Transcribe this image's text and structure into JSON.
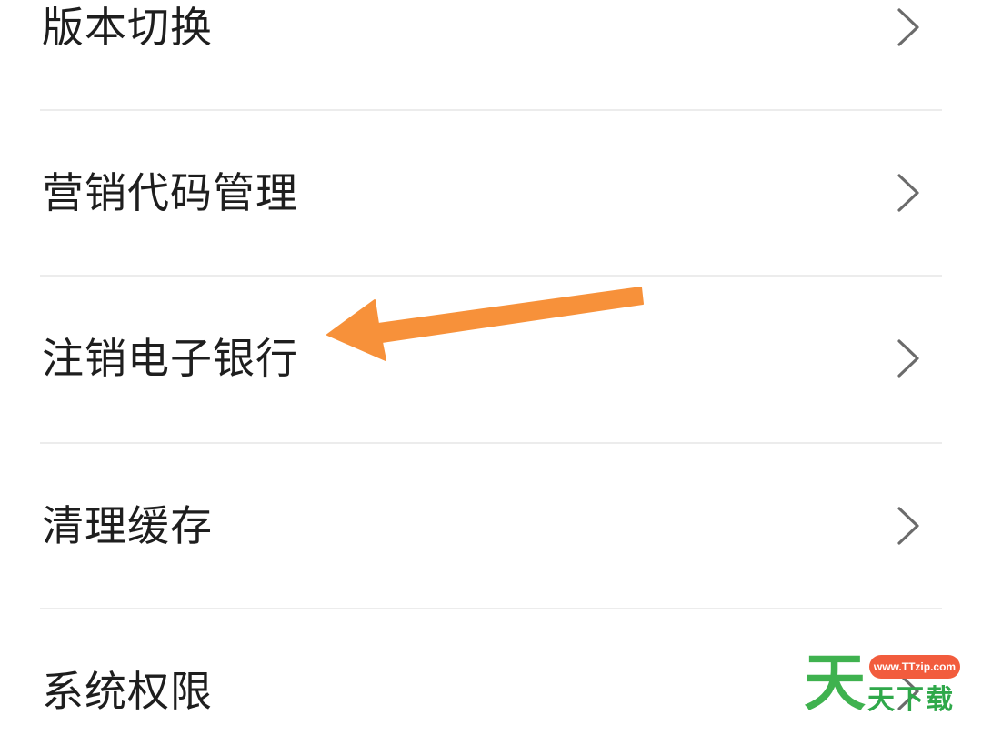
{
  "menu": {
    "items": [
      {
        "label": "版本切换"
      },
      {
        "label": "营销代码管理"
      },
      {
        "label": "注销电子银行"
      },
      {
        "label": "清理缓存"
      },
      {
        "label": "系统权限"
      }
    ]
  },
  "annotation": {
    "arrow_color": "#f7913a",
    "points_to": "注销电子银行"
  },
  "watermark": {
    "url": "www.TTzip.com",
    "big_char": "天",
    "text": "天下载",
    "primary_color": "#3fb24f",
    "badge_color": "#f25c3d"
  },
  "colors": {
    "text": "#1e1e1e",
    "chevron": "#6b6b6b",
    "divider": "#ececec",
    "background": "#ffffff"
  }
}
